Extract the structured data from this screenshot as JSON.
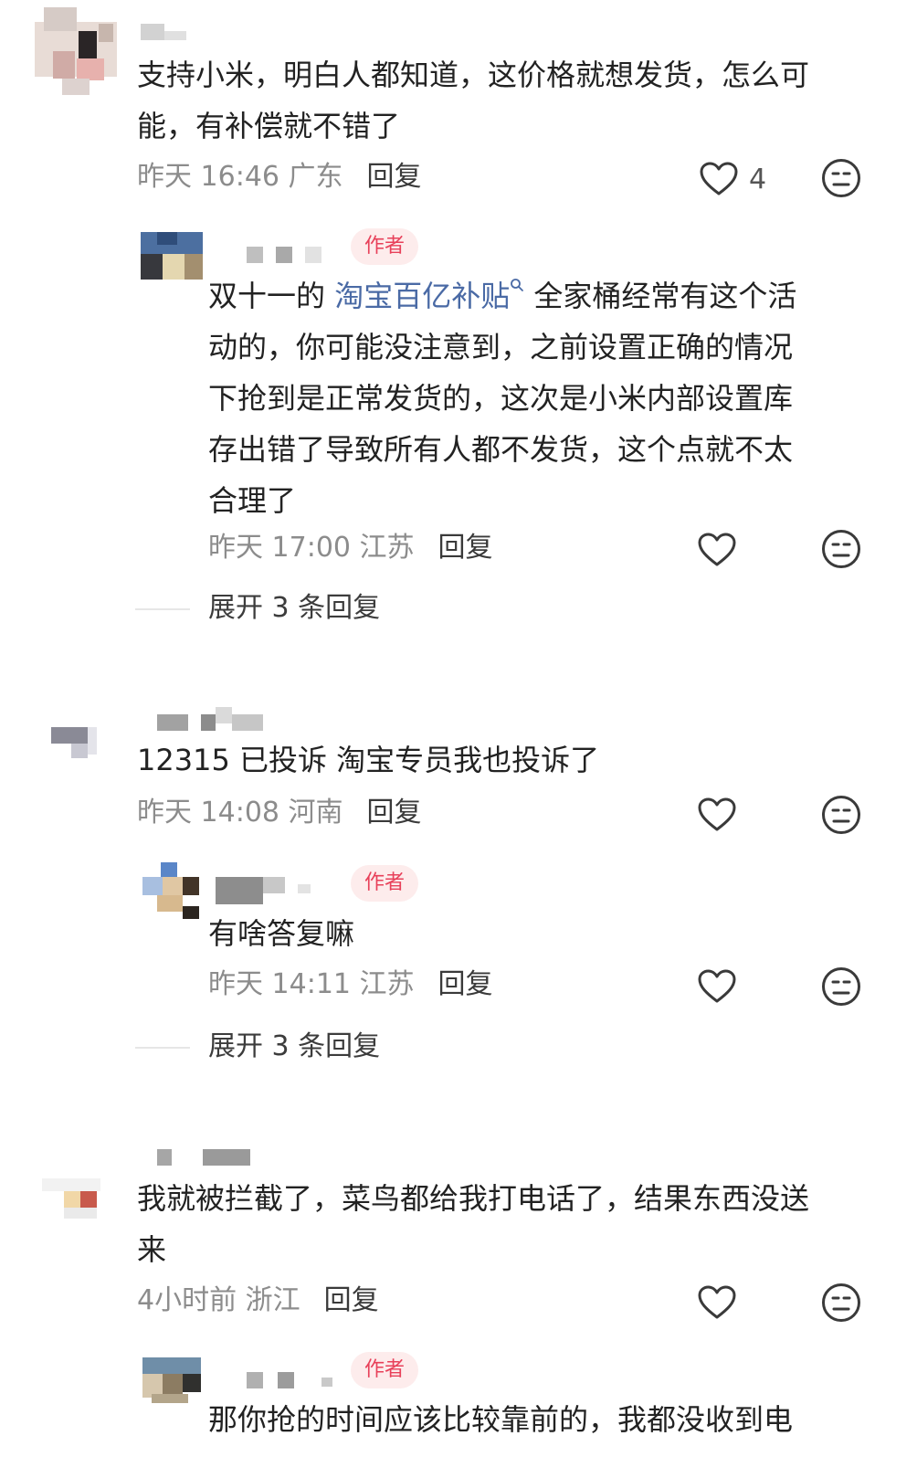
{
  "author_badge": "作者",
  "icons": {
    "like": "heart-outline-icon",
    "dislike": "meh-face-icon",
    "search": "search-icon"
  },
  "comments": [
    {
      "text_lines": [
        "支持小米，明白人都知道，这价格就想发货，怎么可",
        "能，有补偿就不错了"
      ],
      "time": "昨天 16:46 广东",
      "reply": "回复",
      "likes": "4",
      "sub": {
        "badge": "作者",
        "line1_before": "双十一的 ",
        "line1_link": "淘宝百亿补贴",
        "line1_after": " 全家桶经常有这个活",
        "text_lines": [
          "动的，你可能没注意到，之前设置正确的情况",
          "下抢到是正常发货的，这次是小米内部设置库",
          "存出错了导致所有人都不发货，这个点就不太",
          "合理了"
        ],
        "time": "昨天 17:00 江苏",
        "reply": "回复",
        "expand": "展开 3 条回复"
      }
    },
    {
      "text_lines": [
        "12315 已投诉 淘宝专员我也投诉了"
      ],
      "time": "昨天 14:08 河南",
      "reply": "回复",
      "sub": {
        "badge": "作者",
        "text_lines": [
          "有啥答复嘛"
        ],
        "time": "昨天 14:11 江苏",
        "reply": "回复",
        "expand": "展开 3 条回复"
      }
    },
    {
      "text_lines": [
        "我就被拦截了，菜鸟都给我打电话了，结果东西没送",
        "来"
      ],
      "time": "4小时前 浙江",
      "reply": "回复",
      "sub": {
        "badge": "作者",
        "text_lines": [
          "那你抢的时间应该比较靠前的，我都没收到电"
        ]
      }
    }
  ]
}
